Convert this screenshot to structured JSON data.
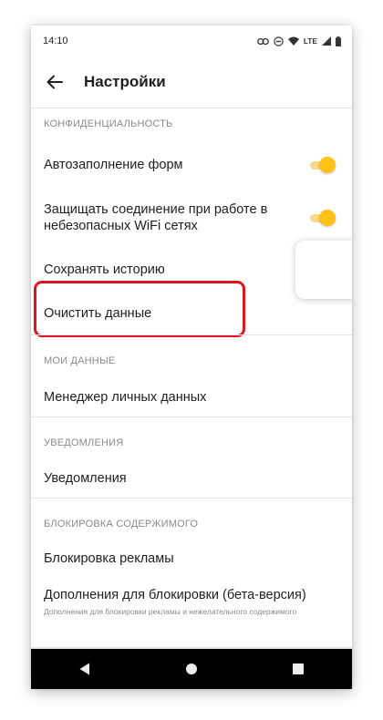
{
  "status_bar": {
    "time": "14:10",
    "network_label": "LTE",
    "icons": [
      "link-icon",
      "do-not-disturb-icon",
      "wifi-icon",
      "signal-icon",
      "battery-icon"
    ]
  },
  "toolbar": {
    "back_icon": "arrow-left-icon",
    "title": "Настройки"
  },
  "sections": {
    "privacy": {
      "header": "КОНФИДЕНЦИАЛЬНОСТЬ",
      "autofill": {
        "label": "Автозаполнение форм",
        "enabled": true
      },
      "protect_wifi": {
        "label": "Защищать соединение при работе в небезопасных WiFi сетях",
        "enabled": true
      },
      "save_history": {
        "label": "Сохранять историю"
      },
      "clear_data": {
        "label": "Очистить данные",
        "highlighted": true
      }
    },
    "my_data": {
      "header": "МОИ ДАННЫЕ",
      "personal_data_manager": {
        "label": "Менеджер личных данных"
      }
    },
    "notifications": {
      "header": "УВЕДОМЛЕНИЯ",
      "notifications_item": {
        "label": "Уведомления"
      }
    },
    "content_blocking": {
      "header": "БЛОКИРОВКА СОДЕРЖИМОГО",
      "ad_blocking": {
        "label": "Блокировка рекламы"
      },
      "blocking_addons": {
        "label": "Дополнения для блокировки (бета-версия)",
        "sublabel": "Дополнения для блокировки рекламы и нежелательного содержимого"
      }
    }
  },
  "colors": {
    "toggle_on_thumb": "#ffc21a",
    "toggle_on_track": "#f8d98a",
    "highlight": "#e0141d",
    "section_header": "#8a8a8a"
  },
  "nav_bar": {
    "buttons": [
      "back-triangle-icon",
      "home-circle-icon",
      "recents-square-icon"
    ]
  }
}
